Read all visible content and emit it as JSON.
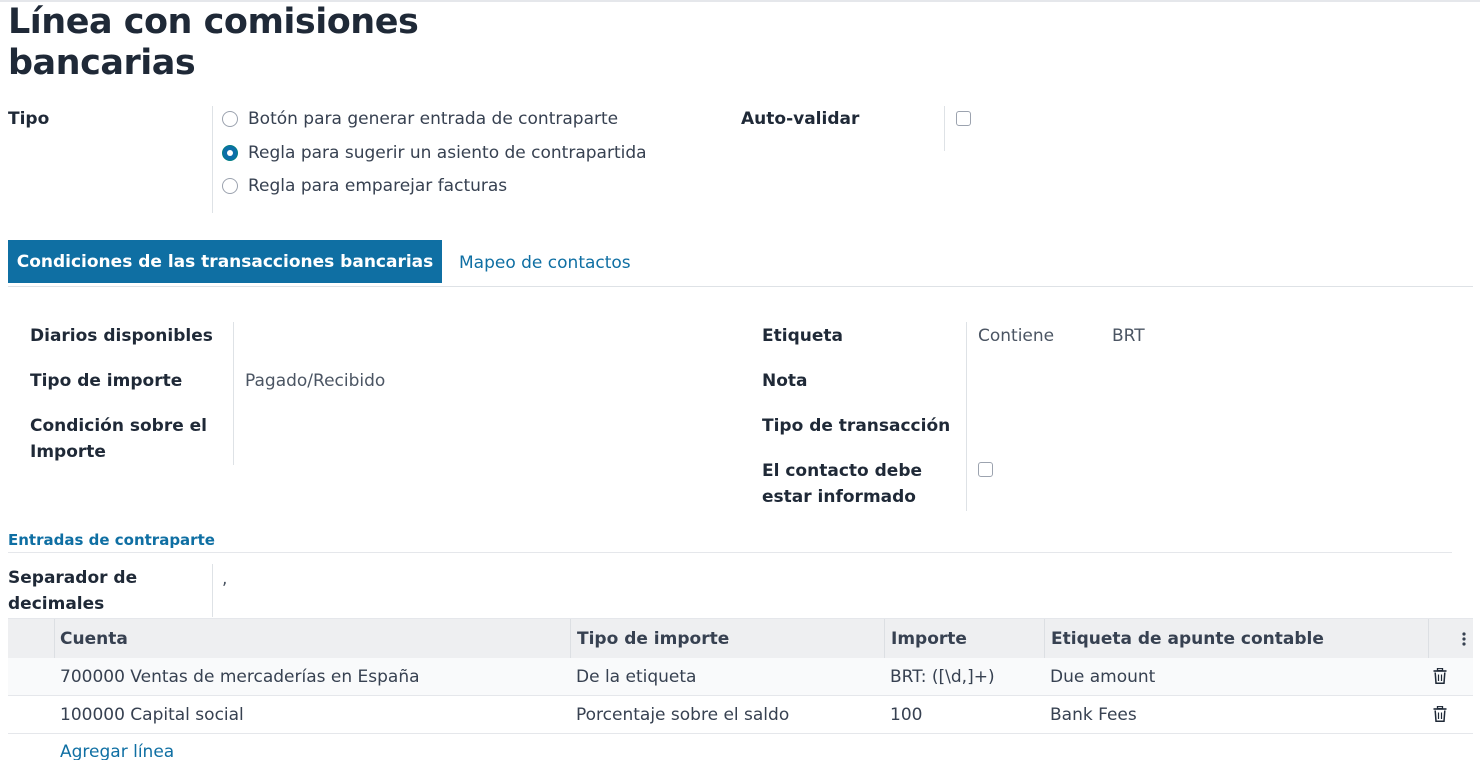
{
  "title": "Línea con comisiones bancarias",
  "tipo": {
    "label": "Tipo",
    "options": [
      {
        "label": "Botón para generar entrada de contraparte",
        "selected": false
      },
      {
        "label": "Regla para sugerir un asiento de contrapartida",
        "selected": true
      },
      {
        "label": "Regla para emparejar facturas",
        "selected": false
      }
    ]
  },
  "auto_validar": {
    "label": "Auto-validar",
    "checked": false
  },
  "tabs": [
    {
      "label": "Condiciones de las transacciones bancarias",
      "active": true
    },
    {
      "label": "Mapeo de contactos",
      "active": false
    }
  ],
  "conditions": {
    "left": [
      {
        "label": "Diarios disponibles",
        "value": ""
      },
      {
        "label": "Tipo de importe",
        "value": "Pagado/Recibido"
      },
      {
        "label": "Condición sobre el Importe",
        "value": ""
      }
    ],
    "etiqueta": {
      "label": "Etiqueta",
      "operator": "Contiene",
      "value": "BRT"
    },
    "nota": {
      "label": "Nota",
      "value": ""
    },
    "tipo_transaccion": {
      "label": "Tipo de transacción",
      "value": ""
    },
    "contacto": {
      "label": "El contacto debe estar informado",
      "checked": false
    }
  },
  "counterpart": {
    "section_title": "Entradas de contraparte",
    "separator_label": "Separador de decimales",
    "separator_value": ",",
    "columns": [
      "Cuenta",
      "Tipo de importe",
      "Importe",
      "Etiqueta de apunte contable"
    ],
    "rows": [
      {
        "cuenta": "700000 Ventas de mercaderías en España",
        "tipo": "De la etiqueta",
        "importe": "BRT: ([\\d,]+)",
        "etiqueta": "Due amount"
      },
      {
        "cuenta": "100000 Capital social",
        "tipo": "Porcentaje sobre el saldo",
        "importe": "100",
        "etiqueta": "Bank Fees"
      }
    ],
    "add_line": "Agregar línea"
  },
  "colors": {
    "accent": "#0f6fa3",
    "header_bg": "#eeeff1"
  },
  "icons": {
    "row_delete": "trash-icon",
    "column_options": "kebab-icon"
  }
}
